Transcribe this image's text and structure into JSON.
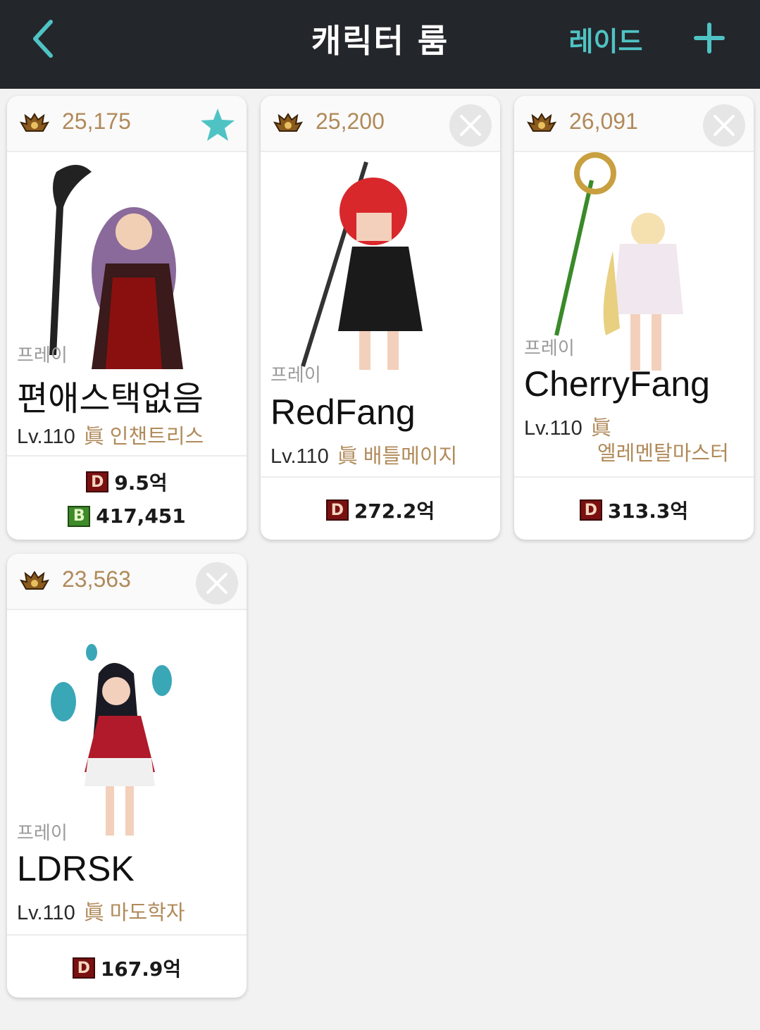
{
  "header": {
    "title": "캐릭터 룸",
    "raid_label": "레이드",
    "back_icon": "chevron-left-icon",
    "add_icon": "plus-icon"
  },
  "accent_color": "#4fc3c4",
  "fame_color": "#b08a5a",
  "cards": [
    {
      "fame": "25,175",
      "favorite": true,
      "server": "프레이",
      "name": "편애스택없음",
      "level": "Lv.110",
      "job_mark": "眞",
      "job": "인챈트리스",
      "stats": [
        {
          "badge": "D",
          "value": "9.5억"
        },
        {
          "badge": "B",
          "value": "417,451"
        }
      ]
    },
    {
      "fame": "25,200",
      "favorite": false,
      "server": "프레이",
      "name": "RedFang",
      "level": "Lv.110",
      "job_mark": "眞",
      "job": "배틀메이지",
      "stats": [
        {
          "badge": "D",
          "value": "272.2억"
        }
      ]
    },
    {
      "fame": "26,091",
      "favorite": false,
      "server": "프레이",
      "name": "CherryFang",
      "level": "Lv.110",
      "job_mark": "眞",
      "job": "엘레멘탈마스터",
      "stats": [
        {
          "badge": "D",
          "value": "313.3억"
        }
      ]
    },
    {
      "fame": "23,563",
      "favorite": false,
      "server": "프레이",
      "name": "LDRSK",
      "level": "Lv.110",
      "job_mark": "眞",
      "job": "마도학자",
      "stats": [
        {
          "badge": "D",
          "value": "167.9억"
        }
      ]
    }
  ]
}
